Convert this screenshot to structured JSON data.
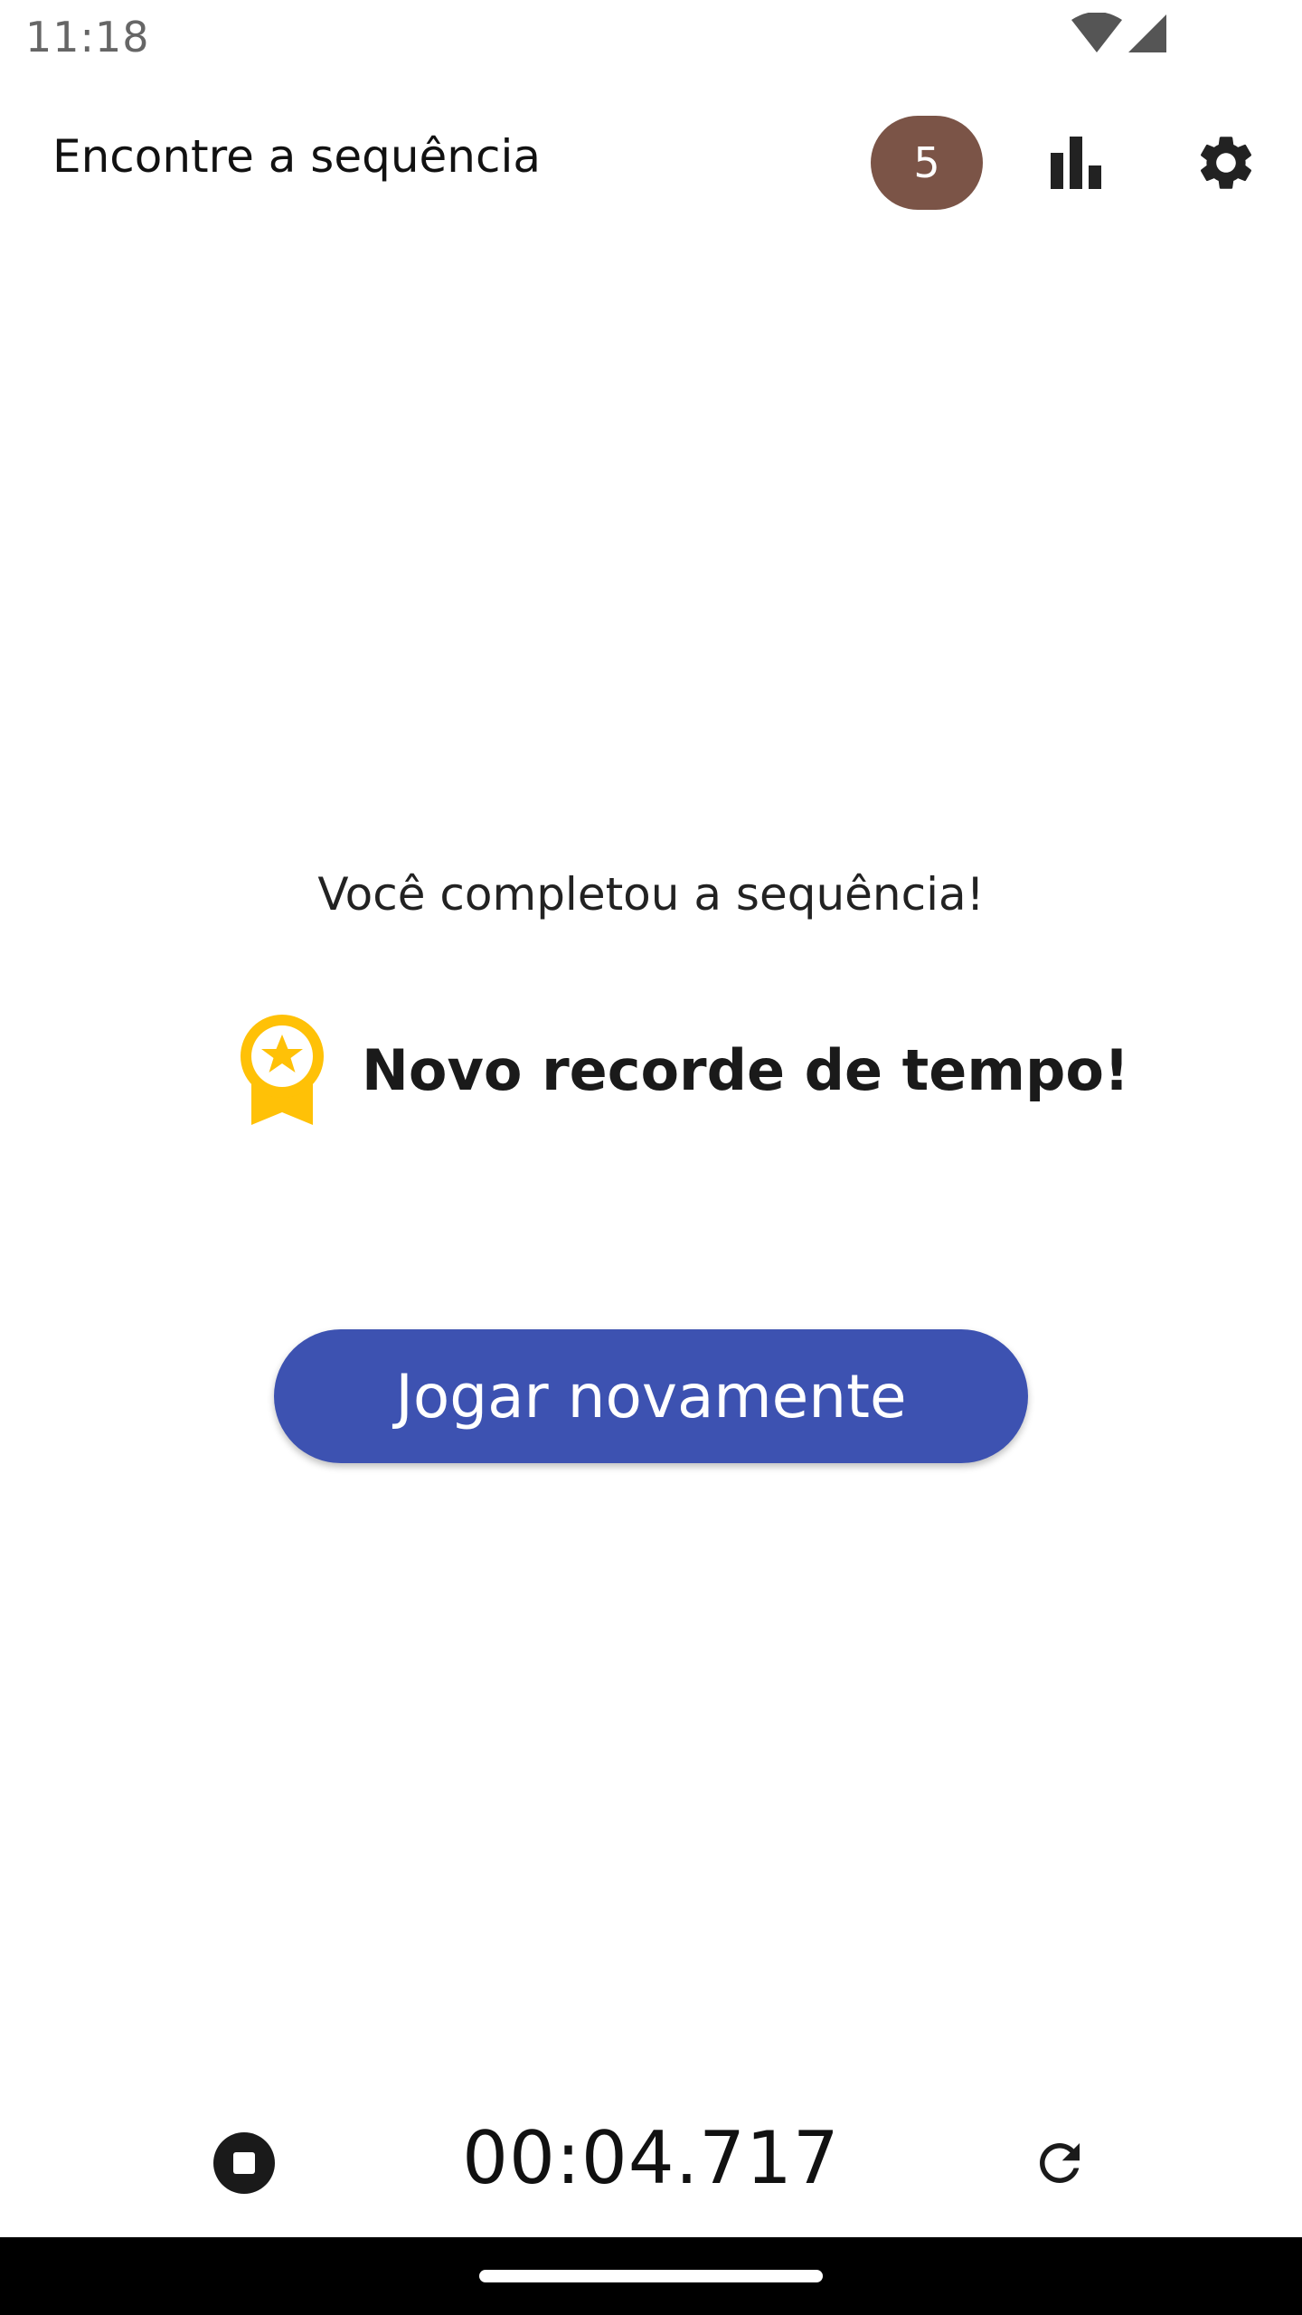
{
  "status_bar": {
    "time": "11:18",
    "icons": [
      "wifi-icon",
      "cell-signal-icon"
    ]
  },
  "app_bar": {
    "title": "Encontre a sequência",
    "streak_count": "5",
    "streak_color": "#7b5447",
    "actions": [
      "bar-chart-icon",
      "gear-icon"
    ]
  },
  "result": {
    "message": "Você completou a sequência!",
    "record_text": "Novo recorde de tempo!",
    "record_icon": "award-medal-icon",
    "medal_color": "#ffc107"
  },
  "play_again": {
    "label": "Jogar novamente",
    "color": "#3d52b1"
  },
  "timer": {
    "value": "00:04.717",
    "controls": [
      "stop-icon",
      "refresh-icon"
    ]
  }
}
